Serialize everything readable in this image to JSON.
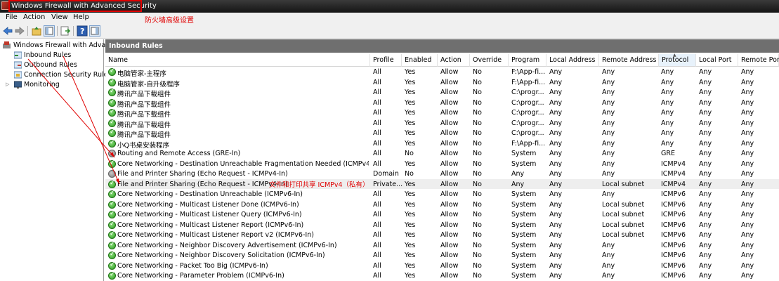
{
  "window": {
    "title": "Windows Firewall with Advanced Security"
  },
  "annotations": {
    "title_note": "防火墙高级设置",
    "row_note": "文件和打印共享 ICMPv4（私有）"
  },
  "menu": [
    "File",
    "Action",
    "View",
    "Help"
  ],
  "tree": {
    "root": "Windows Firewall with Advance",
    "items": [
      "Inbound Rules",
      "Outbound Rules",
      "Connection Security Rules",
      "Monitoring"
    ]
  },
  "pane": {
    "header": "Inbound Rules",
    "columns": [
      "Name",
      "Profile",
      "Enabled",
      "Action",
      "Override",
      "Program",
      "Local Address",
      "Remote Address",
      "Protocol",
      "Local Port",
      "Remote Port"
    ],
    "rows": [
      {
        "enabled_icon": "enabled",
        "cells": [
          "电脑管家-主程序",
          "All",
          "Yes",
          "Allow",
          "No",
          "F:\\App-fi...",
          "Any",
          "Any",
          "Any",
          "Any",
          "Any"
        ]
      },
      {
        "enabled_icon": "enabled",
        "cells": [
          "电脑管家-自升级程序",
          "All",
          "Yes",
          "Allow",
          "No",
          "F:\\App-fi...",
          "Any",
          "Any",
          "Any",
          "Any",
          "Any"
        ]
      },
      {
        "enabled_icon": "enabled",
        "cells": [
          "腾讯产品下载组件",
          "All",
          "Yes",
          "Allow",
          "No",
          "C:\\progr...",
          "Any",
          "Any",
          "Any",
          "Any",
          "Any"
        ]
      },
      {
        "enabled_icon": "enabled",
        "cells": [
          "腾讯产品下载组件",
          "All",
          "Yes",
          "Allow",
          "No",
          "C:\\progr...",
          "Any",
          "Any",
          "Any",
          "Any",
          "Any"
        ]
      },
      {
        "enabled_icon": "enabled",
        "cells": [
          "腾讯产品下载组件",
          "All",
          "Yes",
          "Allow",
          "No",
          "C:\\progr...",
          "Any",
          "Any",
          "Any",
          "Any",
          "Any"
        ]
      },
      {
        "enabled_icon": "enabled",
        "cells": [
          "腾讯产品下载组件",
          "All",
          "Yes",
          "Allow",
          "No",
          "C:\\progr...",
          "Any",
          "Any",
          "Any",
          "Any",
          "Any"
        ]
      },
      {
        "enabled_icon": "enabled",
        "cells": [
          "腾讯产品下载组件",
          "All",
          "Yes",
          "Allow",
          "No",
          "C:\\progr...",
          "Any",
          "Any",
          "Any",
          "Any",
          "Any"
        ]
      },
      {
        "enabled_icon": "enabled",
        "cells": [
          "小Q书桌安装程序",
          "All",
          "Yes",
          "Allow",
          "No",
          "F:\\App-fi...",
          "Any",
          "Any",
          "Any",
          "Any",
          "Any"
        ]
      },
      {
        "enabled_icon": "disabled",
        "cells": [
          "Routing and Remote Access (GRE-In)",
          "All",
          "No",
          "Allow",
          "No",
          "System",
          "Any",
          "Any",
          "GRE",
          "Any",
          "Any"
        ]
      },
      {
        "enabled_icon": "enabled",
        "cells": [
          "Core Networking - Destination Unreachable Fragmentation Needed (ICMPv4-In)",
          "All",
          "Yes",
          "Allow",
          "No",
          "System",
          "Any",
          "Any",
          "ICMPv4",
          "Any",
          "Any"
        ]
      },
      {
        "enabled_icon": "disabled",
        "cells": [
          "File and Printer Sharing (Echo Request - ICMPv4-In)",
          "Domain",
          "No",
          "Allow",
          "No",
          "Any",
          "Any",
          "Any",
          "ICMPv4",
          "Any",
          "Any"
        ]
      },
      {
        "enabled_icon": "enabled",
        "selected": true,
        "cells": [
          "File and Printer Sharing (Echo Request - ICMPv4-In)",
          "Private...",
          "Yes",
          "Allow",
          "No",
          "Any",
          "Any",
          "Local subnet",
          "ICMPv4",
          "Any",
          "Any"
        ]
      },
      {
        "enabled_icon": "enabled",
        "cells": [
          "Core Networking - Destination Unreachable (ICMPv6-In)",
          "All",
          "Yes",
          "Allow",
          "No",
          "System",
          "Any",
          "Any",
          "ICMPv6",
          "Any",
          "Any"
        ]
      },
      {
        "enabled_icon": "enabled",
        "cells": [
          "Core Networking - Multicast Listener Done (ICMPv6-In)",
          "All",
          "Yes",
          "Allow",
          "No",
          "System",
          "Any",
          "Local subnet",
          "ICMPv6",
          "Any",
          "Any"
        ]
      },
      {
        "enabled_icon": "enabled",
        "cells": [
          "Core Networking - Multicast Listener Query (ICMPv6-In)",
          "All",
          "Yes",
          "Allow",
          "No",
          "System",
          "Any",
          "Local subnet",
          "ICMPv6",
          "Any",
          "Any"
        ]
      },
      {
        "enabled_icon": "enabled",
        "cells": [
          "Core Networking - Multicast Listener Report (ICMPv6-In)",
          "All",
          "Yes",
          "Allow",
          "No",
          "System",
          "Any",
          "Local subnet",
          "ICMPv6",
          "Any",
          "Any"
        ]
      },
      {
        "enabled_icon": "enabled",
        "cells": [
          "Core Networking - Multicast Listener Report v2 (ICMPv6-In)",
          "All",
          "Yes",
          "Allow",
          "No",
          "System",
          "Any",
          "Local subnet",
          "ICMPv6",
          "Any",
          "Any"
        ]
      },
      {
        "enabled_icon": "enabled",
        "cells": [
          "Core Networking - Neighbor Discovery Advertisement (ICMPv6-In)",
          "All",
          "Yes",
          "Allow",
          "No",
          "System",
          "Any",
          "Any",
          "ICMPv6",
          "Any",
          "Any"
        ]
      },
      {
        "enabled_icon": "enabled",
        "cells": [
          "Core Networking - Neighbor Discovery Solicitation (ICMPv6-In)",
          "All",
          "Yes",
          "Allow",
          "No",
          "System",
          "Any",
          "Any",
          "ICMPv6",
          "Any",
          "Any"
        ]
      },
      {
        "enabled_icon": "enabled",
        "cells": [
          "Core Networking - Packet Too Big (ICMPv6-In)",
          "All",
          "Yes",
          "Allow",
          "No",
          "System",
          "Any",
          "Any",
          "ICMPv6",
          "Any",
          "Any"
        ]
      },
      {
        "enabled_icon": "enabled",
        "cells": [
          "Core Networking - Parameter Problem (ICMPv6-In)",
          "All",
          "Yes",
          "Allow",
          "No",
          "System",
          "Any",
          "Any",
          "ICMPv6",
          "Any",
          "Any"
        ]
      }
    ]
  }
}
